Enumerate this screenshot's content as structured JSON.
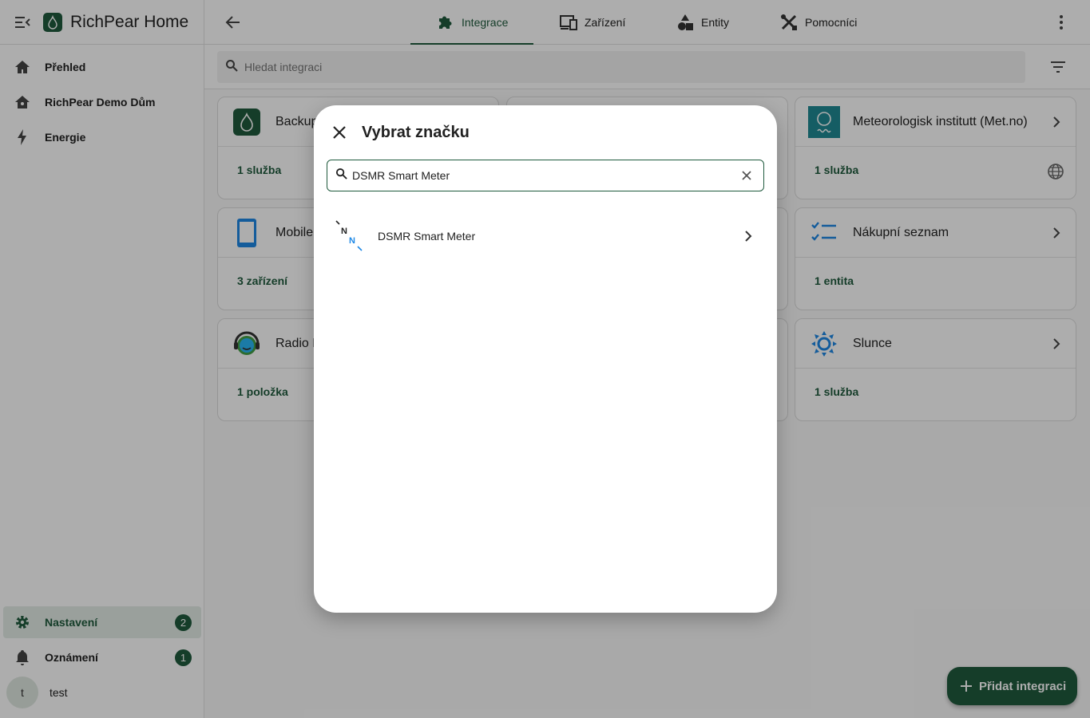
{
  "app": {
    "title": "RichPear Home"
  },
  "sidebar": {
    "items": [
      {
        "label": "Přehled",
        "icon": "home-icon"
      },
      {
        "label": "RichPear Demo Dům",
        "icon": "home-roof-icon"
      },
      {
        "label": "Energie",
        "icon": "lightning-icon"
      }
    ],
    "bottom": [
      {
        "label": "Nastavení",
        "icon": "gear-icon",
        "badge": "2"
      },
      {
        "label": "Oznámení",
        "icon": "bell-icon",
        "badge": "1"
      }
    ],
    "user": {
      "initial": "t",
      "name": "test"
    }
  },
  "tabs": [
    {
      "label": "Integrace",
      "icon": "puzzle-icon",
      "active": true
    },
    {
      "label": "Zařízení",
      "icon": "devices-icon",
      "active": false
    },
    {
      "label": "Entity",
      "icon": "shapes-icon",
      "active": false
    },
    {
      "label": "Pomocníci",
      "icon": "tools-icon",
      "active": false
    }
  ],
  "search": {
    "placeholder": "Hledat integraci"
  },
  "cards": [
    {
      "name": "Backup",
      "footer": "1 služba",
      "icon": "backup-icon"
    },
    {
      "name": "Meteorologisk institutt (Met.no)",
      "footer": "1 služba",
      "icon": "metno-icon"
    },
    {
      "name": "Mobile App",
      "footer": "3 zařízení",
      "icon": "phone-icon"
    },
    {
      "name": "Nákupní seznam",
      "footer": "1 entita",
      "icon": "checklist-icon"
    },
    {
      "name": "Radio Browser",
      "footer": "1 položka",
      "icon": "radio-icon"
    },
    {
      "name": "Slunce",
      "footer": "1 služba",
      "icon": "sun-icon"
    }
  ],
  "dialog": {
    "title": "Vybrat značku",
    "search_value": "DSMR Smart Meter",
    "results": [
      {
        "label": "DSMR Smart Meter",
        "icon": "dsmr-logo"
      }
    ]
  },
  "fab": {
    "label": "Přidat integraci"
  },
  "colors": {
    "accent": "#1f5a3d",
    "scrim": "rgba(0,0,0,0.32)"
  }
}
